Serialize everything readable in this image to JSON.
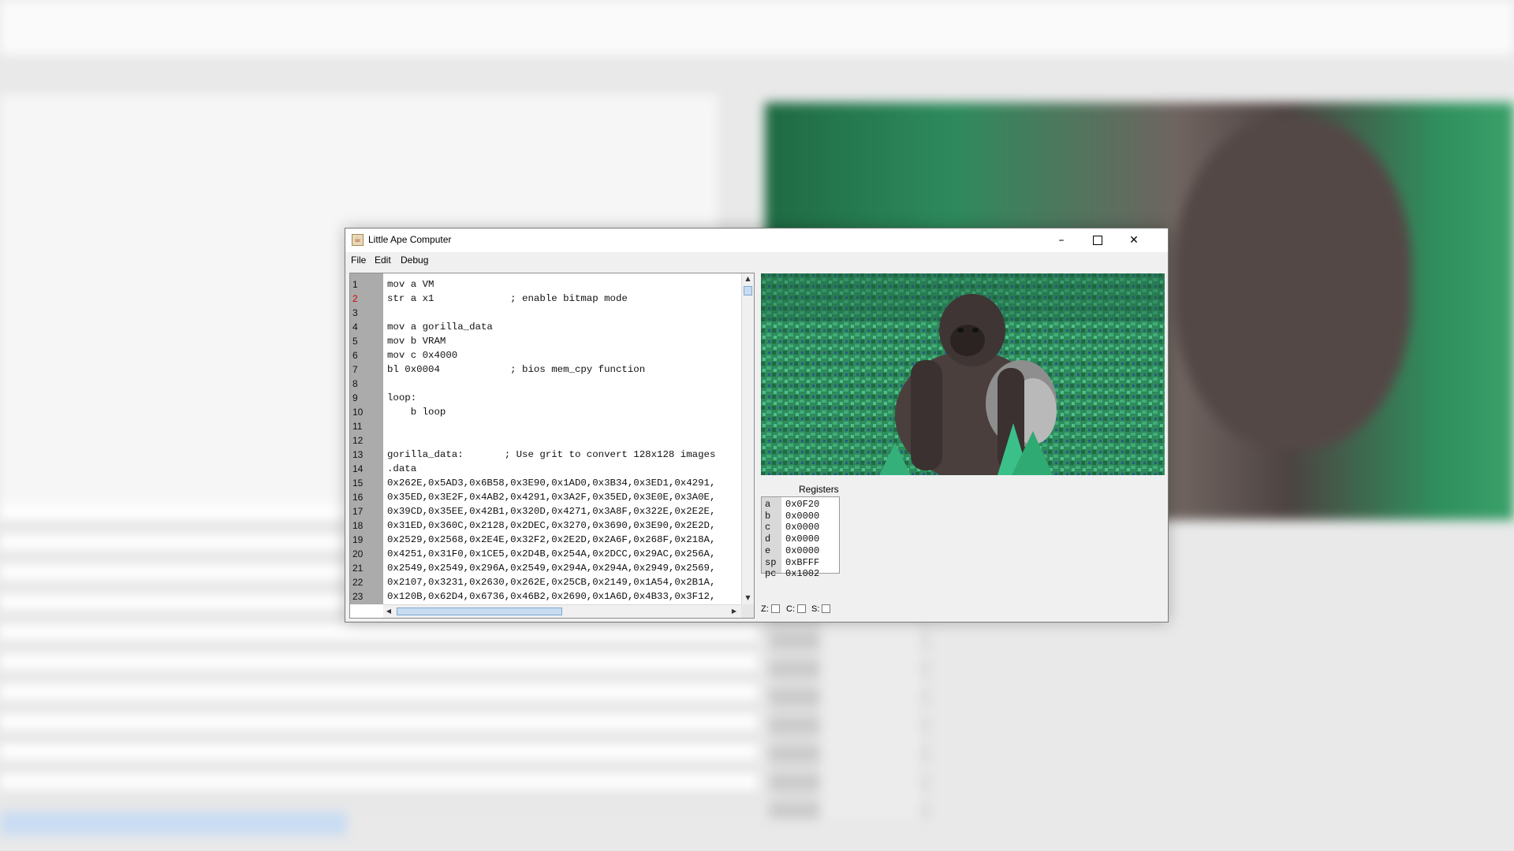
{
  "window": {
    "title": "Little Ape Computer",
    "controls": {
      "minimize": "–",
      "maximize": "",
      "close": "✕"
    }
  },
  "menu": [
    {
      "label": "File"
    },
    {
      "label": "Edit"
    },
    {
      "label": "Debug"
    }
  ],
  "editor": {
    "highlighted_line": 2,
    "lines": [
      {
        "n": "1",
        "code": "mov a VM"
      },
      {
        "n": "2",
        "code": "str a x1             ; enable bitmap mode"
      },
      {
        "n": "3",
        "code": ""
      },
      {
        "n": "4",
        "code": "mov a gorilla_data"
      },
      {
        "n": "5",
        "code": "mov b VRAM"
      },
      {
        "n": "6",
        "code": "mov c 0x4000"
      },
      {
        "n": "7",
        "code": "bl 0x0004            ; bios mem_cpy function"
      },
      {
        "n": "8",
        "code": ""
      },
      {
        "n": "9",
        "code": "loop:"
      },
      {
        "n": "10",
        "code": "    b loop"
      },
      {
        "n": "11",
        "code": ""
      },
      {
        "n": "12",
        "code": ""
      },
      {
        "n": "13",
        "code": "gorilla_data:       ; Use grit to convert 128x128 images"
      },
      {
        "n": "14",
        "code": ".data"
      },
      {
        "n": "15",
        "code": "0x262E,0x5AD3,0x6B58,0x3E90,0x1AD0,0x3B34,0x3ED1,0x4291,"
      },
      {
        "n": "16",
        "code": "0x35ED,0x3E2F,0x4AB2,0x4291,0x3A2F,0x35ED,0x3E0E,0x3A0E,"
      },
      {
        "n": "17",
        "code": "0x39CD,0x35EE,0x42B1,0x320D,0x4271,0x3A8F,0x322E,0x2E2E,"
      },
      {
        "n": "18",
        "code": "0x31ED,0x360C,0x2128,0x2DEC,0x3270,0x3690,0x3E90,0x2E2D,"
      },
      {
        "n": "19",
        "code": "0x2529,0x2568,0x2E4E,0x32F2,0x2E2D,0x2A6F,0x268F,0x218A,"
      },
      {
        "n": "20",
        "code": "0x4251,0x31F0,0x1CE5,0x2D4B,0x254A,0x2DCC,0x29AC,0x256A,"
      },
      {
        "n": "21",
        "code": "0x2549,0x2549,0x296A,0x2549,0x294A,0x294A,0x2949,0x2569,"
      },
      {
        "n": "22",
        "code": "0x2107,0x3231,0x2630,0x262E,0x25CB,0x2149,0x1A54,0x2B1A,"
      },
      {
        "n": "23",
        "code": "0x120B,0x62D4,0x6736,0x46B2,0x2690,0x1A6D,0x4B33,0x3F12,"
      }
    ],
    "scroll": {
      "up": "▲",
      "down": "▼",
      "left": "◀",
      "right": "▶"
    }
  },
  "display": {
    "description": "gorilla-bitmap",
    "icon": "gorilla-image"
  },
  "registers": {
    "title": "Registers",
    "rows": [
      {
        "name": "a",
        "value": "0x0F20"
      },
      {
        "name": "b",
        "value": "0x0000"
      },
      {
        "name": "c",
        "value": "0x0000"
      },
      {
        "name": "d",
        "value": "0x0000"
      },
      {
        "name": "e",
        "value": "0x0000"
      },
      {
        "name": "sp",
        "value": "0xBFFF"
      },
      {
        "name": "pc",
        "value": "0x1002"
      }
    ]
  },
  "flags": [
    {
      "label": "Z:",
      "checked": false
    },
    {
      "label": "C:",
      "checked": false
    },
    {
      "label": "S:",
      "checked": false
    }
  ],
  "colors": {
    "gutter": "#ababab",
    "highlighted_line_number": "#d40000",
    "scroll_thumb": "#c8dcf1",
    "jungle_green": "#2f8a5c",
    "gorilla_brown": "#4a3f3d"
  }
}
